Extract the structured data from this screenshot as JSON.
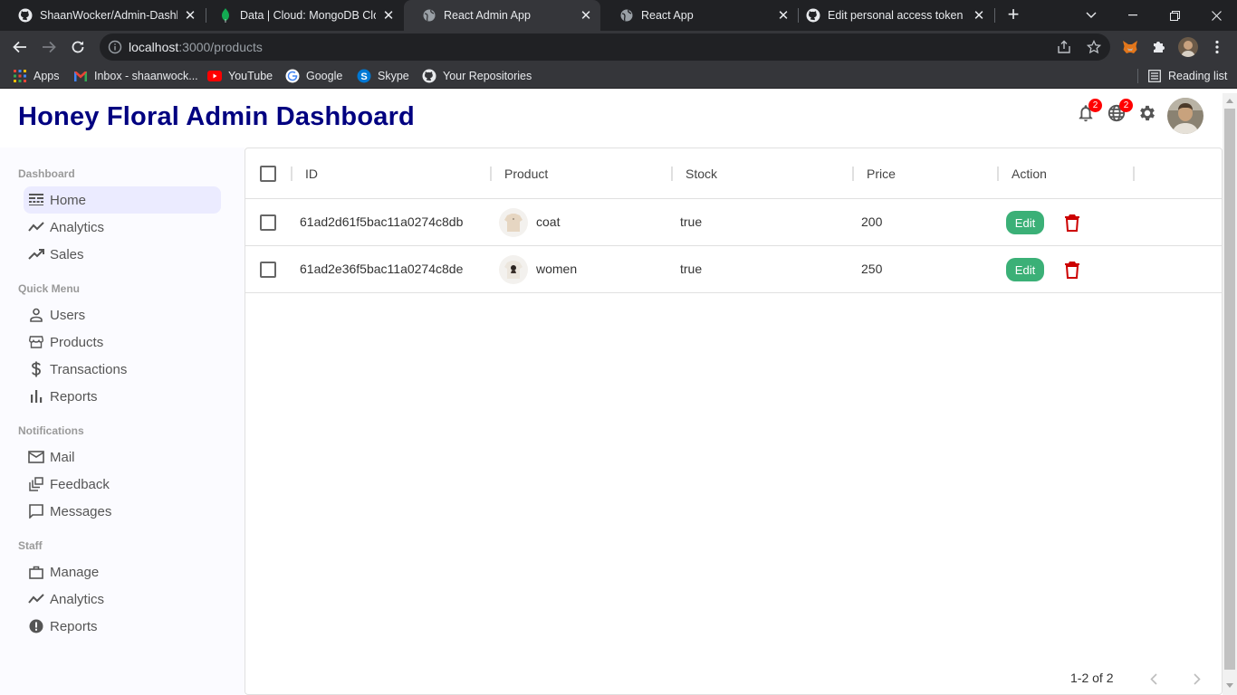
{
  "browser": {
    "tabs": [
      {
        "title": "ShaanWocker/Admin-Dashboard",
        "icon": "github-icon"
      },
      {
        "title": "Data | Cloud: MongoDB Cloud",
        "icon": "mongodb-leaf-icon"
      },
      {
        "title": "React Admin App",
        "icon": "globe-icon"
      },
      {
        "title": "React App",
        "icon": "globe-icon"
      },
      {
        "title": "Edit personal access token",
        "icon": "github-icon"
      }
    ],
    "url_host": "localhost",
    "url_path": ":3000/products",
    "bookmarks": [
      "Apps",
      "Inbox - shaanwock...",
      "YouTube",
      "Google",
      "Skype",
      "Your Repositories"
    ],
    "reading_list": "Reading list"
  },
  "header": {
    "title": "Honey Floral Admin Dashboard",
    "notifications_badge": "2",
    "language_badge": "2"
  },
  "sidebar": {
    "sections": [
      {
        "title": "Dashboard",
        "items": [
          {
            "label": "Home",
            "icon": "line-style-icon"
          },
          {
            "label": "Analytics",
            "icon": "timeline-icon"
          },
          {
            "label": "Sales",
            "icon": "trending-up-icon"
          }
        ]
      },
      {
        "title": "Quick Menu",
        "items": [
          {
            "label": "Users",
            "icon": "person-outline-icon"
          },
          {
            "label": "Products",
            "icon": "storefront-icon"
          },
          {
            "label": "Transactions",
            "icon": "dollar-icon"
          },
          {
            "label": "Reports",
            "icon": "bar-chart-icon"
          }
        ]
      },
      {
        "title": "Notifications",
        "items": [
          {
            "label": "Mail",
            "icon": "mail-outline-icon"
          },
          {
            "label": "Feedback",
            "icon": "dynamic-feed-icon"
          },
          {
            "label": "Messages",
            "icon": "chat-bubble-outline-icon"
          }
        ]
      },
      {
        "title": "Staff",
        "items": [
          {
            "label": "Manage",
            "icon": "work-outline-icon"
          },
          {
            "label": "Analytics",
            "icon": "timeline-icon"
          },
          {
            "label": "Reports",
            "icon": "report-icon"
          }
        ]
      }
    ]
  },
  "table": {
    "columns": [
      "ID",
      "Product",
      "Stock",
      "Price",
      "Action"
    ],
    "rows": [
      {
        "id": "61ad2d61f5bac11a0274c8db",
        "product": "coat",
        "stock": "true",
        "price": "200",
        "edit": "Edit"
      },
      {
        "id": "61ad2e36f5bac11a0274c8de",
        "product": "women",
        "stock": "true",
        "price": "250",
        "edit": "Edit"
      }
    ],
    "pagination": "1-2 of 2"
  },
  "colors": {
    "brand_title": "#000080",
    "edit_button": "#3bb077",
    "delete_icon": "#cc0000",
    "badge": "#ff0000"
  }
}
